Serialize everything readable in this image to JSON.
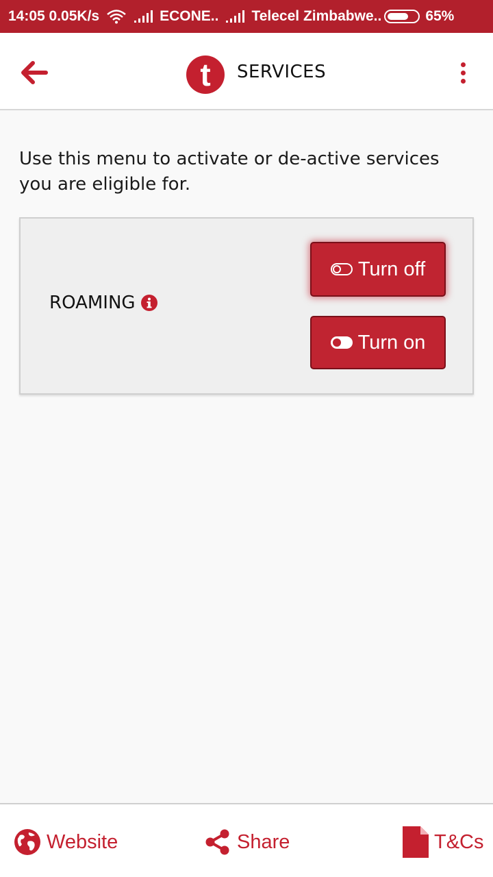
{
  "status_bar": {
    "time_speed": "14:05 0.05K/s",
    "carrier1": "ECONE..",
    "carrier2": "Telecel Zimbabwe..",
    "battery": "65%"
  },
  "app_bar": {
    "logo_letter": "t",
    "title": "SERVICES"
  },
  "main": {
    "intro": "Use this menu to activate or de-active services you are eligible for.",
    "services": [
      {
        "name": "ROAMING",
        "turn_off_label": "Turn off",
        "turn_on_label": "Turn on"
      }
    ]
  },
  "bottom_nav": {
    "website_label": "Website",
    "share_label": "Share",
    "tcs_label": "T&Cs"
  },
  "colors": {
    "brand_red": "#c4202f",
    "status_bar": "#b2202c"
  }
}
